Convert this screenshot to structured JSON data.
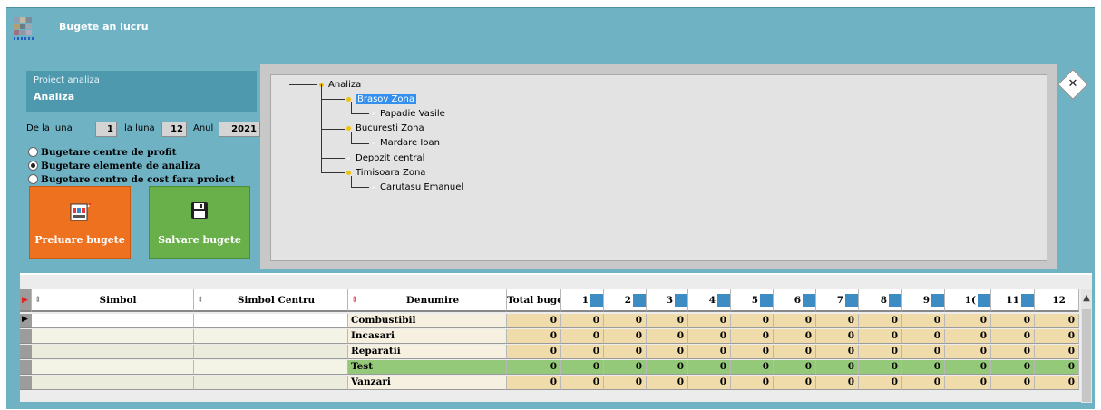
{
  "window": {
    "title": "Bugete an lucru"
  },
  "project": {
    "label": "Proiect analiza",
    "value": "Analiza"
  },
  "period": {
    "from_label": "De la luna",
    "from_value": "1",
    "to_label": "la luna",
    "to_value": "12",
    "year_label": "Anul",
    "year_value": "2021"
  },
  "options": [
    {
      "label": "Bugetare centre de profit",
      "selected": false
    },
    {
      "label": "Bugetare elemente de analiza",
      "selected": true
    },
    {
      "label": "Bugetare centre de cost fara proiect",
      "selected": false
    }
  ],
  "buttons": {
    "load_label": "Preluare bugete",
    "save_label": "Salvare bugete"
  },
  "tree": [
    {
      "label": "Analiza",
      "level": 0,
      "leaf": false,
      "selected": false
    },
    {
      "label": "Brasov Zona",
      "level": 1,
      "leaf": false,
      "selected": true
    },
    {
      "label": "Papadie Vasile",
      "level": 2,
      "leaf": true,
      "selected": false
    },
    {
      "label": "Bucuresti Zona",
      "level": 1,
      "leaf": false,
      "selected": false
    },
    {
      "label": "Mardare Ioan",
      "level": 2,
      "leaf": true,
      "selected": false
    },
    {
      "label": "Depozit central",
      "level": 1,
      "leaf": true,
      "selected": false
    },
    {
      "label": "Timisoara Zona",
      "level": 1,
      "leaf": false,
      "selected": false
    },
    {
      "label": "Carutasu Emanuel",
      "level": 2,
      "leaf": true,
      "selected": false
    }
  ],
  "grid": {
    "columns": [
      "Simbol",
      "Simbol Centru",
      "Denumire",
      "Total buge",
      "1",
      "2",
      "3",
      "4",
      "5",
      "6",
      "7",
      "8",
      "9",
      "1(",
      "11",
      "12"
    ],
    "rows": [
      {
        "denumire": "Combustibil",
        "values": [
          "0",
          "0",
          "0",
          "0",
          "0",
          "0",
          "0",
          "0",
          "0",
          "0",
          "0",
          "0",
          "0"
        ]
      },
      {
        "denumire": "Incasari",
        "values": [
          "0",
          "0",
          "0",
          "0",
          "0",
          "0",
          "0",
          "0",
          "0",
          "0",
          "0",
          "0",
          "0"
        ]
      },
      {
        "denumire": "Reparatii",
        "values": [
          "0",
          "0",
          "0",
          "0",
          "0",
          "0",
          "0",
          "0",
          "0",
          "0",
          "0",
          "0",
          "0"
        ]
      },
      {
        "denumire": "Test",
        "values": [
          "0",
          "0",
          "0",
          "0",
          "0",
          "0",
          "0",
          "0",
          "0",
          "0",
          "0",
          "0",
          "0"
        ]
      },
      {
        "denumire": "Vanzari",
        "values": [
          "0",
          "0",
          "0",
          "0",
          "0",
          "0",
          "0",
          "0",
          "0",
          "0",
          "0",
          "0",
          "0"
        ]
      }
    ]
  },
  "colors": {
    "window_bg": "#6fb2c4",
    "load_button": "#ee7120",
    "save_button": "#69b04a",
    "row_tan": "#f0dcaa",
    "row_green": "#95c97a",
    "tree_selected": "#3390ee"
  },
  "icons": {
    "app": "app-mosaic-icon",
    "load": "slot-machine-icon",
    "save": "floppy-disk-icon",
    "close": "close-icon"
  }
}
